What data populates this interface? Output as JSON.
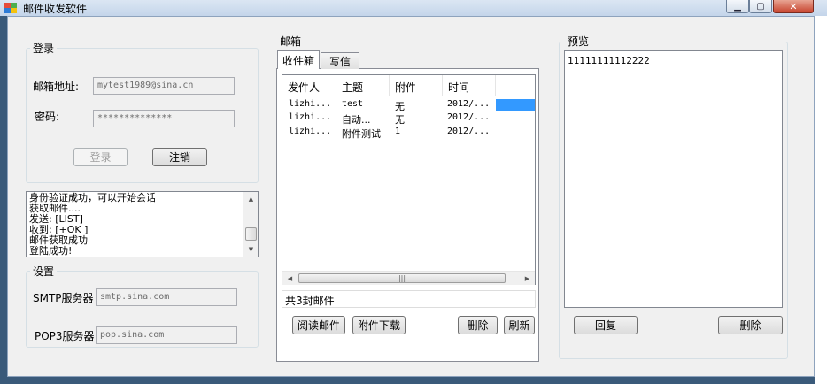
{
  "window": {
    "title": "邮件收发软件"
  },
  "login": {
    "legend": "登录",
    "email_label": "邮箱地址:",
    "email_value": "mytest1989@sina.cn",
    "password_label": "密码:",
    "password_value": "**************",
    "login_button": "登录",
    "logout_button": "注销"
  },
  "log": {
    "lines": [
      "身份验证成功，可以开始会话",
      "获取邮件....",
      "发送: [LIST]",
      "收到: [+OK ]",
      "邮件获取成功",
      "登陆成功!"
    ]
  },
  "settings": {
    "legend": "设置",
    "smtp_label": "SMTP服务器",
    "smtp_value": "smtp.sina.com",
    "pop3_label": "POP3服务器",
    "pop3_value": "pop.sina.com"
  },
  "mailbox": {
    "legend": "邮箱",
    "tabs": [
      "收件箱",
      "写信"
    ],
    "columns": [
      "发件人",
      "主题",
      "附件",
      "时间"
    ],
    "rows": [
      {
        "sender": "lizhi...",
        "subject": "test",
        "attachment": "无",
        "time": "2012/..."
      },
      {
        "sender": "lizhi...",
        "subject": "自动...",
        "attachment": "无",
        "time": "2012/..."
      },
      {
        "sender": "lizhi...",
        "subject": "附件测试",
        "attachment": "1",
        "time": "2012/..."
      }
    ],
    "status": "共3封邮件",
    "buttons": {
      "read": "阅读邮件",
      "download": "附件下载",
      "delete": "删除",
      "refresh": "刷新"
    }
  },
  "preview": {
    "legend": "预览",
    "content": "11111111112222",
    "reply_button": "回复",
    "delete_button": "删除"
  },
  "colors": {
    "selection": "#3399ff",
    "title_bar": "#c4d5ea",
    "close_button": "#c7442e"
  }
}
